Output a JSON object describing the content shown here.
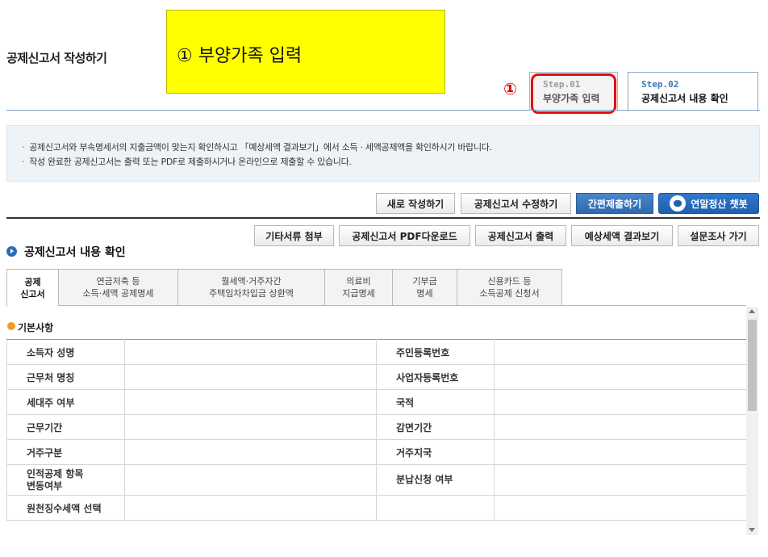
{
  "header": {
    "page_title": "공제신고서 작성하기",
    "callout": "① 부양가족 입력",
    "annotation_number": "①",
    "steps": [
      {
        "num": "Step.01",
        "label": "부양가족 입력"
      },
      {
        "num": "Step.02",
        "label": "공제신고서 내용 확인"
      }
    ]
  },
  "notice": [
    "공제신고서와 부속명세서의 지출금액이 맞는지 확인하시고 「예상세액 결과보기」에서 소득 · 세액공제액을 확인하시기 바랍니다.",
    "작성 완료한 공제신고서는 출력 또는 PDF로 제출하시거나 온라인으로 제출할 수 있습니다."
  ],
  "top_buttons": {
    "new": "새로 작성하기",
    "edit": "공제신고서 수정하기",
    "simple_submit": "간편제출하기",
    "chatbot": "연말정산 챗봇"
  },
  "action_buttons": {
    "attach": "기타서류 첨부",
    "pdf": "공제신고서 PDF다운로드",
    "print": "공제신고서 출력",
    "estimate": "예상세액 결과보기",
    "survey": "설문조사 가기"
  },
  "section_title": "공제신고서 내용 확인",
  "tabs": [
    {
      "line1": "공제",
      "line2": "신고서"
    },
    {
      "line1": "연금저축 등",
      "line2": "소득·세액 공제명세"
    },
    {
      "line1": "월세액·거주자간",
      "line2": "주택임차차입금 상환액"
    },
    {
      "line1": "의료비",
      "line2": "지급명세"
    },
    {
      "line1": "기부금",
      "line2": "명세"
    },
    {
      "line1": "신용카드 등",
      "line2": "소득공제 신청서"
    }
  ],
  "basic_info": {
    "title": "기본사항",
    "rows": [
      {
        "l1": "소득자 성명",
        "l2": "주민등록번호"
      },
      {
        "l1": "근무처 명칭",
        "l2": "사업자등록번호"
      },
      {
        "l1": "세대주 여부",
        "l2": "국적"
      },
      {
        "l1": "근무기간",
        "l2": "감면기간"
      },
      {
        "l1": "거주구분",
        "l2": "거주지국"
      },
      {
        "l1a": "인적공제 항목",
        "l1b": "변동여부",
        "l2": "분납신청 여부"
      },
      {
        "l1": "원천징수세액 선택",
        "l2": ""
      }
    ]
  },
  "colors": {
    "callout_bg": "#ffff00",
    "highlight_red": "#e41010",
    "accent_blue": "#2f68ad"
  }
}
